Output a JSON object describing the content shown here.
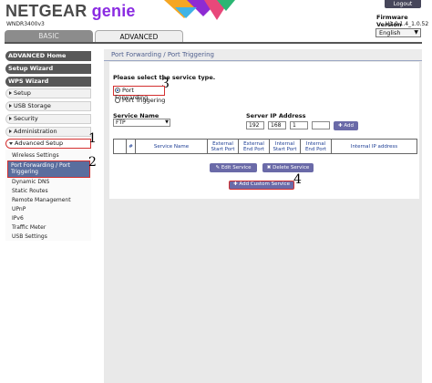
{
  "header": {
    "brand": "NETGEAR",
    "product": "genie",
    "model": "WNDR3400v3",
    "logout_label": "Logout",
    "firmware_label": "Firmware Version",
    "firmware_value": "V1.0.1.4_1.0.52",
    "language": "English"
  },
  "tabs": [
    {
      "label": "BASIC"
    },
    {
      "label": "ADVANCED"
    }
  ],
  "sidebar": {
    "advanced_home": "ADVANCED Home",
    "setup_wizard": "Setup Wizard",
    "wps_wizard": "WPS Wizard",
    "items": [
      {
        "label": "Setup"
      },
      {
        "label": "USB Storage"
      },
      {
        "label": "Security"
      },
      {
        "label": "Administration"
      },
      {
        "label": "Advanced Setup"
      }
    ],
    "subitems": [
      {
        "label": "Wireless Settings"
      },
      {
        "label": "Port Forwarding / Port Triggering"
      },
      {
        "label": "Dynamic DNS"
      },
      {
        "label": "Static Routes"
      },
      {
        "label": "Remote Management"
      },
      {
        "label": "UPnP"
      },
      {
        "label": "IPv6"
      },
      {
        "label": "Traffic Meter"
      },
      {
        "label": "USB Settings"
      }
    ]
  },
  "annotations": {
    "n1": "1",
    "n2": "2",
    "n3": "3",
    "n4": "4"
  },
  "main": {
    "title": "Port Forwarding / Port Triggering",
    "service_type_prompt": "Please select the service type.",
    "radio_port_forwarding": "Port Forwarding",
    "radio_port_triggering": "Port Triggering",
    "service_name_label": "Service Name",
    "service_name_value": "FTP",
    "server_ip_label": "Server IP Address",
    "ip": [
      "192",
      "168",
      "1",
      ""
    ],
    "add_button": "Add",
    "table_headers": [
      "",
      "#",
      "Service Name",
      "External Start Port",
      "External End Port",
      "Internal Start Port",
      "Internal End Port",
      "Internal IP address"
    ],
    "edit_button": "Edit Service",
    "delete_button": "Delete Service",
    "add_custom_button": "Add Custom Service"
  },
  "colors": {
    "accent": "#6a6aa8",
    "highlight_box": "#d32f2f",
    "title_blue": "#4f5f8e",
    "sidebar_dark": "#585858"
  }
}
